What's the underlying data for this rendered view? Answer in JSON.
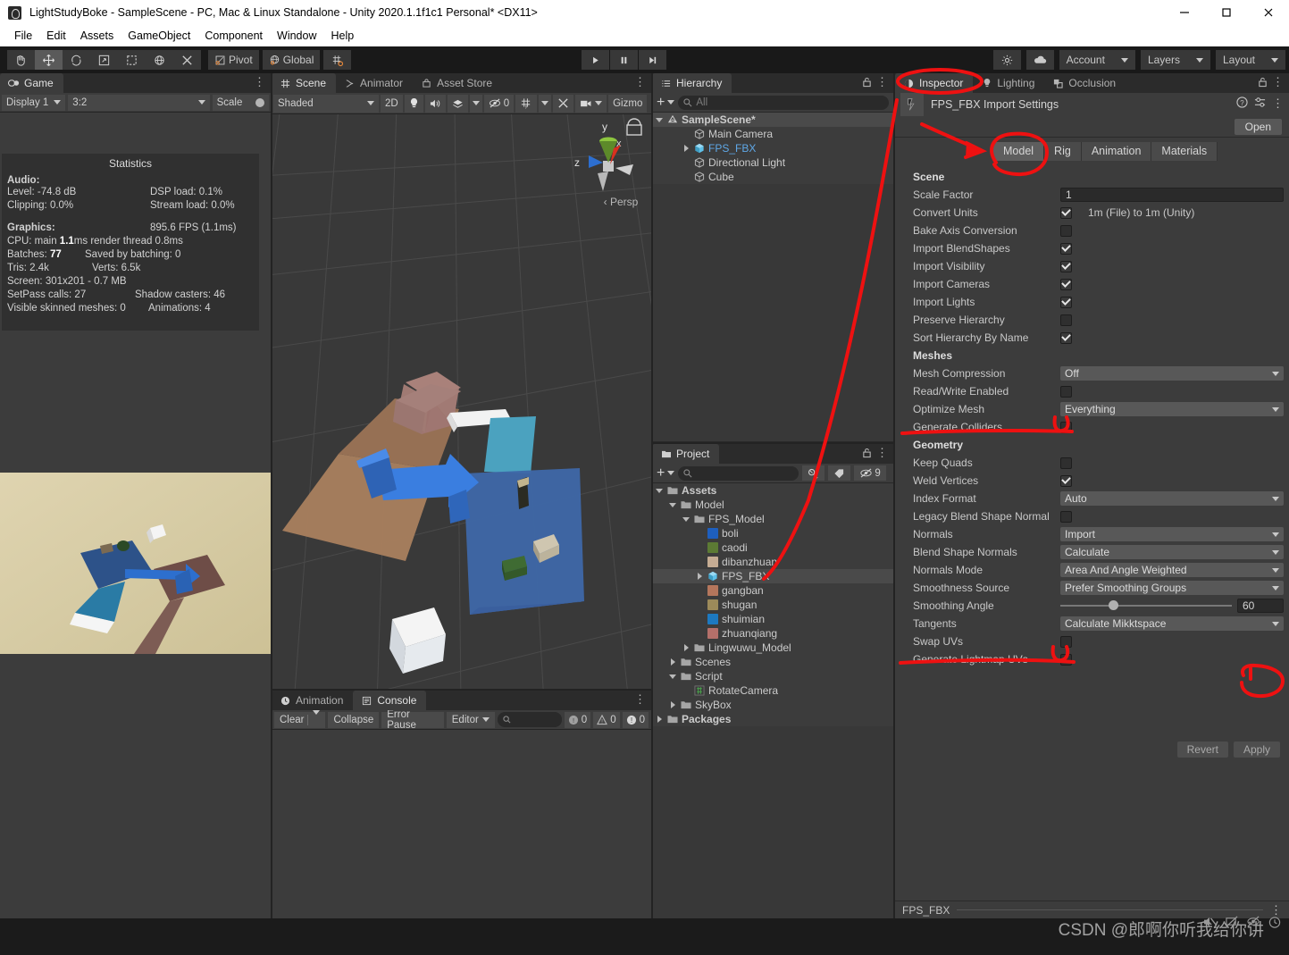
{
  "window": {
    "title": "LightStudyBoke - SampleScene - PC, Mac & Linux Standalone - Unity 2020.1.1f1c1 Personal* <DX11>",
    "minimize": "—",
    "maximize": "▢",
    "close": "✕"
  },
  "menu": {
    "items": [
      "File",
      "Edit",
      "Assets",
      "GameObject",
      "Component",
      "Window",
      "Help"
    ]
  },
  "toolbar": {
    "tools": [
      "hand-tool",
      "move-tool",
      "rotate-tool",
      "scale-tool",
      "rect-tool",
      "transform-tool",
      "custom-tool"
    ],
    "pivot_label": "Pivot",
    "global_label": "Global",
    "play": "▶",
    "pause": "❚❚",
    "step": "▶❚",
    "account_label": "Account",
    "layers_label": "Layers",
    "layout_label": "Layout"
  },
  "game": {
    "tab": "Game",
    "display": "Display 1",
    "aspect": "3:2",
    "scale_label": "Scale",
    "stats": {
      "title": "Statistics",
      "audio_header": "Audio:",
      "level": "Level: -74.8 dB",
      "dsp": "DSP load: 0.1%",
      "clipping": "Clipping: 0.0%",
      "stream": "Stream load: 0.0%",
      "graphics_header": "Graphics:",
      "fps": "895.6 FPS (1.1ms)",
      "cpu_pre": "CPU: main ",
      "cpu_bold": "1.1",
      "cpu_post": "ms  render thread 0.8ms",
      "batches_pre": "Batches: ",
      "batches_bold": "77",
      "saved_batching": "Saved by batching: 0",
      "tris": "Tris: 2.4k",
      "verts": "Verts: 6.5k",
      "screen": "Screen: 301x201 - 0.7 MB",
      "setpass": "SetPass calls: 27",
      "shadow": "Shadow casters: 46",
      "skinned": "Visible skinned meshes: 0",
      "animations": "Animations: 4"
    }
  },
  "scene": {
    "tabs": [
      {
        "label": "Scene",
        "icon": "grid-icon",
        "selected": true
      },
      {
        "label": "Animator",
        "icon": "animator-icon",
        "selected": false
      },
      {
        "label": "Asset Store",
        "icon": "store-icon",
        "selected": false
      }
    ],
    "shading": "Shaded",
    "mode2d": "2D",
    "effects_count": "0",
    "gizmos_label": "Gizmo",
    "persp_label": "Persp",
    "axis_x": "x",
    "axis_y": "y",
    "axis_z": "z"
  },
  "console": {
    "tabs": [
      {
        "label": "Animation",
        "icon": "clock-icon",
        "selected": false
      },
      {
        "label": "Console",
        "icon": "console-icon",
        "selected": true
      }
    ],
    "clear": "Clear",
    "collapse": "Collapse",
    "error_pause": "Error Pause",
    "editor": "Editor",
    "search_placeholder": "",
    "log_count": "0",
    "warn_count": "0",
    "error_count": "0"
  },
  "hierarchy": {
    "tab": "Hierarchy",
    "search_placeholder": "All",
    "items": [
      {
        "label": "SampleScene*",
        "depth": 0,
        "arrow": "down",
        "icon": "scene-icon",
        "selected": true,
        "bold": true
      },
      {
        "label": "Main Camera",
        "depth": 2,
        "arrow": "",
        "icon": "gameobject-icon",
        "selected": false
      },
      {
        "label": "FPS_FBX",
        "depth": 2,
        "arrow": "right",
        "icon": "prefab-icon",
        "selected": false,
        "blue": true
      },
      {
        "label": "Directional Light",
        "depth": 2,
        "arrow": "",
        "icon": "gameobject-icon",
        "selected": false
      },
      {
        "label": "Cube",
        "depth": 2,
        "arrow": "",
        "icon": "gameobject-icon",
        "selected": false
      }
    ]
  },
  "project": {
    "tab": "Project",
    "search_placeholder": "",
    "hidden_count": "9",
    "items": [
      {
        "label": "Assets",
        "depth": 0,
        "arrow": "down",
        "icon": "folder-open",
        "bold": true
      },
      {
        "label": "Model",
        "depth": 1,
        "arrow": "down",
        "icon": "folder-open"
      },
      {
        "label": "FPS_Model",
        "depth": 2,
        "arrow": "down",
        "icon": "folder-open"
      },
      {
        "label": "boli",
        "depth": 3,
        "arrow": "",
        "icon": "material-swatch",
        "color": "#1e5fbe"
      },
      {
        "label": "caodi",
        "depth": 3,
        "arrow": "",
        "icon": "material-swatch",
        "color": "#5c7a34"
      },
      {
        "label": "dibanzhuan",
        "depth": 3,
        "arrow": "",
        "icon": "material-swatch",
        "color": "#c5ac93"
      },
      {
        "label": "FPS_FBX",
        "depth": 3,
        "arrow": "right",
        "icon": "prefab-icon",
        "selected": true
      },
      {
        "label": "gangban",
        "depth": 3,
        "arrow": "",
        "icon": "material-swatch",
        "color": "#b4765c"
      },
      {
        "label": "shugan",
        "depth": 3,
        "arrow": "",
        "icon": "material-swatch",
        "color": "#9c8a5a"
      },
      {
        "label": "shuimian",
        "depth": 3,
        "arrow": "",
        "icon": "material-swatch",
        "color": "#1d79c0"
      },
      {
        "label": "zhuanqiang",
        "depth": 3,
        "arrow": "",
        "icon": "material-swatch",
        "color": "#b4706a"
      },
      {
        "label": "Lingwuwu_Model",
        "depth": 2,
        "arrow": "right",
        "icon": "folder"
      },
      {
        "label": "Scenes",
        "depth": 1,
        "arrow": "right",
        "icon": "folder"
      },
      {
        "label": "Script",
        "depth": 1,
        "arrow": "down",
        "icon": "folder-open"
      },
      {
        "label": "RotateCamera",
        "depth": 2,
        "arrow": "",
        "icon": "cs-script-icon"
      },
      {
        "label": "SkyBox",
        "depth": 1,
        "arrow": "right",
        "icon": "folder"
      },
      {
        "label": "Packages",
        "depth": 0,
        "arrow": "right",
        "icon": "folder",
        "bold": true
      }
    ]
  },
  "inspector": {
    "tabs": [
      {
        "label": "Inspector",
        "icon": "inspector-icon",
        "selected": true
      },
      {
        "label": "Lighting",
        "icon": "lighting-icon",
        "selected": false
      },
      {
        "label": "Occlusion",
        "icon": "occlusion-icon",
        "selected": false
      }
    ],
    "asset_title": "FPS_FBX Import Settings",
    "open_label": "Open",
    "model_tabs": [
      {
        "label": "Model",
        "selected": true
      },
      {
        "label": "Rig",
        "selected": false
      },
      {
        "label": "Animation",
        "selected": false
      },
      {
        "label": "Materials",
        "selected": false
      }
    ],
    "properties": [
      {
        "kind": "header",
        "label": "Scene"
      },
      {
        "kind": "field",
        "label": "Scale Factor",
        "value": "1"
      },
      {
        "kind": "check",
        "label": "Convert Units",
        "checked": true,
        "suffix": "1m (File) to 1m (Unity)"
      },
      {
        "kind": "check",
        "label": "Bake Axis Conversion",
        "checked": false
      },
      {
        "kind": "check",
        "label": "Import BlendShapes",
        "checked": true
      },
      {
        "kind": "check",
        "label": "Import Visibility",
        "checked": true
      },
      {
        "kind": "check",
        "label": "Import Cameras",
        "checked": true
      },
      {
        "kind": "check",
        "label": "Import Lights",
        "checked": true
      },
      {
        "kind": "check",
        "label": "Preserve Hierarchy",
        "checked": false
      },
      {
        "kind": "check",
        "label": "Sort Hierarchy By Name",
        "checked": true
      },
      {
        "kind": "header",
        "label": "Meshes"
      },
      {
        "kind": "popup",
        "label": "Mesh Compression",
        "value": "Off"
      },
      {
        "kind": "check",
        "label": "Read/Write Enabled",
        "checked": false
      },
      {
        "kind": "popup",
        "label": "Optimize Mesh",
        "value": "Everything"
      },
      {
        "kind": "check",
        "label": "Generate Colliders",
        "checked": false
      },
      {
        "kind": "header",
        "label": "Geometry"
      },
      {
        "kind": "check",
        "label": "Keep Quads",
        "checked": false
      },
      {
        "kind": "check",
        "label": "Weld Vertices",
        "checked": true
      },
      {
        "kind": "popup",
        "label": "Index Format",
        "value": "Auto"
      },
      {
        "kind": "check",
        "label": "Legacy Blend Shape Normal",
        "checked": false
      },
      {
        "kind": "popup",
        "label": "Normals",
        "value": "Import"
      },
      {
        "kind": "popup",
        "label": "Blend Shape Normals",
        "value": "Calculate"
      },
      {
        "kind": "popup",
        "label": "Normals Mode",
        "value": "Area And Angle Weighted"
      },
      {
        "kind": "popup",
        "label": "Smoothness Source",
        "value": "Prefer Smoothing Groups"
      },
      {
        "kind": "slider",
        "label": "Smoothing Angle",
        "value": "60"
      },
      {
        "kind": "popup",
        "label": "Tangents",
        "value": "Calculate Mikktspace"
      },
      {
        "kind": "check",
        "label": "Swap UVs",
        "checked": false
      },
      {
        "kind": "check",
        "label": "Generate Lightmap UVs",
        "checked": false
      }
    ],
    "revert_label": "Revert",
    "apply_label": "Apply",
    "footer_label": "FPS_FBX"
  },
  "status": {
    "watermark": "CSDN @郎啊你听我给你讲"
  },
  "colors": {
    "annotation": "#ee1111",
    "panel_bg": "#3c3c3c",
    "toolbar_bg": "#191919",
    "accent_blue": "#4a90d9"
  }
}
